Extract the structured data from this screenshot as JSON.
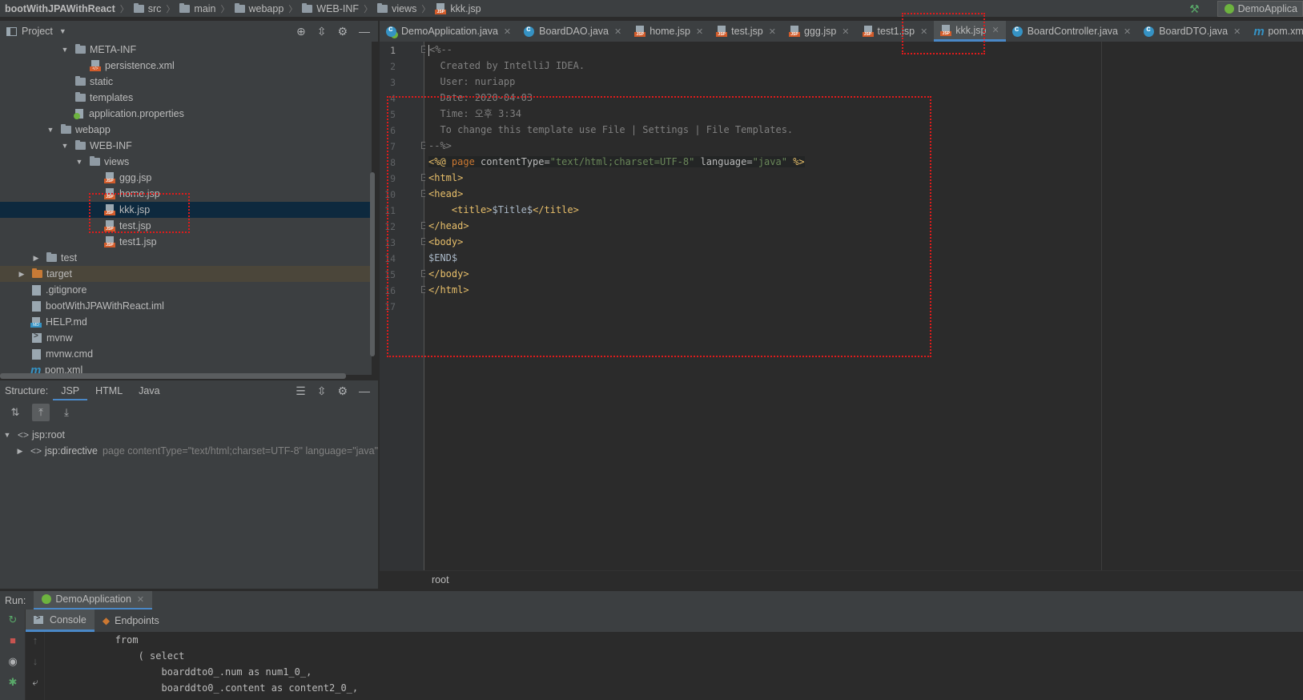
{
  "navbar": {
    "crumbs": [
      "bootWithJPAWithReact",
      "src",
      "main",
      "webapp",
      "WEB-INF",
      "views",
      "kkk.jsp"
    ],
    "run_config": "DemoApplica"
  },
  "project_panel": {
    "title": "Project",
    "tree": [
      {
        "label": "META-INF",
        "type": "folder",
        "expanded": true
      },
      {
        "label": "persistence.xml",
        "type": "xml"
      },
      {
        "label": "static",
        "type": "folder"
      },
      {
        "label": "templates",
        "type": "folder"
      },
      {
        "label": "application.properties",
        "type": "properties"
      },
      {
        "label": "webapp",
        "type": "folder",
        "expanded": true
      },
      {
        "label": "WEB-INF",
        "type": "folder",
        "expanded": true
      },
      {
        "label": "views",
        "type": "folder",
        "expanded": true
      },
      {
        "label": "ggg.jsp",
        "type": "jsp"
      },
      {
        "label": "home.jsp",
        "type": "jsp"
      },
      {
        "label": "kkk.jsp",
        "type": "jsp",
        "selected": true
      },
      {
        "label": "test.jsp",
        "type": "jsp"
      },
      {
        "label": "test1.jsp",
        "type": "jsp"
      },
      {
        "label": "test",
        "type": "folder",
        "expanded": false
      },
      {
        "label": "target",
        "type": "folder-orange",
        "expanded": false
      },
      {
        "label": ".gitignore",
        "type": "file"
      },
      {
        "label": "bootWithJPAWithReact.iml",
        "type": "file"
      },
      {
        "label": "HELP.md",
        "type": "md"
      },
      {
        "label": "mvnw",
        "type": "sh"
      },
      {
        "label": "mvnw.cmd",
        "type": "file"
      },
      {
        "label": "pom.xml",
        "type": "maven"
      }
    ]
  },
  "structure_panel": {
    "title": "Structure:",
    "tabs": [
      "JSP",
      "HTML",
      "Java"
    ],
    "active_tab": "JSP",
    "nodes": [
      {
        "label": "jsp:root",
        "detail": ""
      },
      {
        "label": "jsp:directive",
        "detail": "page contentType=\"text/html;charset=UTF-8\" language=\"java\""
      }
    ]
  },
  "editor": {
    "tabs": [
      {
        "label": "DemoApplication.java",
        "icon": "spring-java-icon"
      },
      {
        "label": "BoardDAO.java",
        "icon": "java-class-icon"
      },
      {
        "label": "home.jsp",
        "icon": "jsp-file-icon"
      },
      {
        "label": "test.jsp",
        "icon": "jsp-file-icon"
      },
      {
        "label": "ggg.jsp",
        "icon": "jsp-file-icon"
      },
      {
        "label": "test1.jsp",
        "icon": "jsp-file-icon"
      },
      {
        "label": "kkk.jsp",
        "icon": "jsp-file-icon",
        "active": true
      },
      {
        "label": "BoardController.java",
        "icon": "java-class-icon"
      },
      {
        "label": "BoardDTO.java",
        "icon": "java-class-icon"
      },
      {
        "label": "pom.xml",
        "icon": "maven-icon"
      }
    ],
    "line_numbers": [
      "1",
      "2",
      "3",
      "4",
      "5",
      "6",
      "7",
      "8",
      "9",
      "10",
      "11",
      "12",
      "13",
      "14",
      "15",
      "16",
      "17"
    ],
    "lines": {
      "l1": "<%--",
      "l2": "  Created by IntelliJ IDEA.",
      "l3": "  User: nuriapp",
      "l4": "  Date: 2020-04-03",
      "l5": "  Time: 오후 3:34",
      "l6": "  To change this template use File | Settings | File Templates.",
      "l7": "--%>",
      "l8_open": "<%@ ",
      "l8_page": "page",
      "l8_attr1": " contentType=",
      "l8_val1": "\"text/html;charset=UTF-8\"",
      "l8_attr2": " language=",
      "l8_val2": "\"java\"",
      "l8_close": " %>",
      "l9": "<html>",
      "l10": "<head>",
      "l11_open": "    <title>",
      "l11_text": "$Title$",
      "l11_close": "</title>",
      "l12": "</head>",
      "l13": "<body>",
      "l14": "$END$",
      "l15": "</body>",
      "l16": "</html>"
    },
    "breadcrumb": "root"
  },
  "run_panel": {
    "label": "Run:",
    "config": "DemoApplication",
    "tabs": [
      "Console",
      "Endpoints"
    ],
    "console_lines": [
      "            from",
      "                ( select",
      "                    boarddto0_.num as num1_0_,",
      "                    boarddto0_.content as content2_0_,"
    ]
  },
  "colors": {
    "annotation": "#e01b1b",
    "accent": "#4a88c7",
    "tag": "#e8bf6a",
    "string": "#6a8759",
    "comment": "#808080"
  }
}
